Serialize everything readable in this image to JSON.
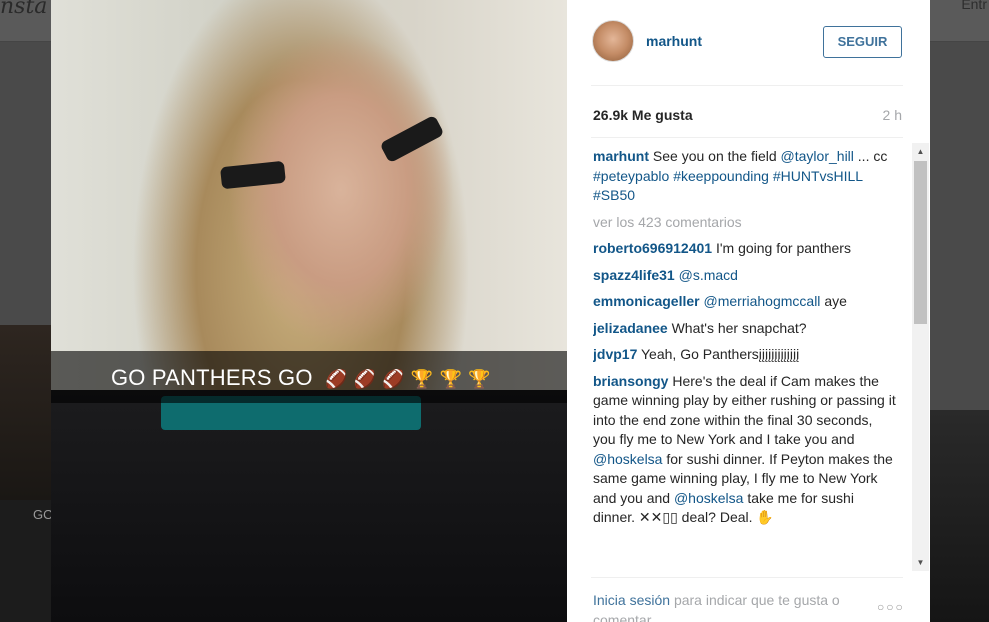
{
  "background": {
    "logo_text": "nsta",
    "login_text": "Entr",
    "side_caption": "GO"
  },
  "post": {
    "photo_caption": "GO PANTHERS GO",
    "photo_emojis": [
      "football-icon",
      "football-icon",
      "football-icon",
      "trophy-icon",
      "trophy-icon",
      "trophy-icon"
    ],
    "username": "marhunt",
    "follow_label": "SEGUIR",
    "likes": "26.9k Me gusta",
    "time": "2 h",
    "caption": {
      "user": "marhunt",
      "text": "See you on the field",
      "mention": "@taylor_hill",
      "middle": "... cc",
      "tag1": "#peteypablo",
      "tags_line": "#keeppounding #HUNTvsHILL #SB50"
    },
    "view_more": "ver los 423 comentarios",
    "comments": [
      {
        "user": "roberto696912401",
        "text": "I'm going for panthers"
      },
      {
        "user": "spazz4life31",
        "mention": "@s.macd"
      },
      {
        "user": "emmonicageller",
        "mention": "@merriahogmccall",
        "text": "aye"
      },
      {
        "user": "jelizadanee",
        "text": "What's her snapchat?"
      },
      {
        "user": "jdvp17",
        "text": "Yeah, Go Panthersįįįįįįįįįįįįį"
      },
      {
        "user": "briansongy",
        "text_a": "Here's the deal if Cam makes the game winning play by either rushing or passing it into the end zone within the final 30 seconds, you fly me to New York and I take you and",
        "mention_a": "@hoskelsa",
        "text_b": "for sushi dinner. If Peyton makes the same game winning play, I fly me to New York and you and",
        "mention_b": "@hoskelsa",
        "text_c": "take me for sushi dinner. ✕✕▯▯ deal? Deal. ✋"
      }
    ],
    "footer": {
      "login_link": "Inicia sesión",
      "login_rest": "para indicar que te gusta o comentar",
      "more_label": "○○○"
    }
  }
}
